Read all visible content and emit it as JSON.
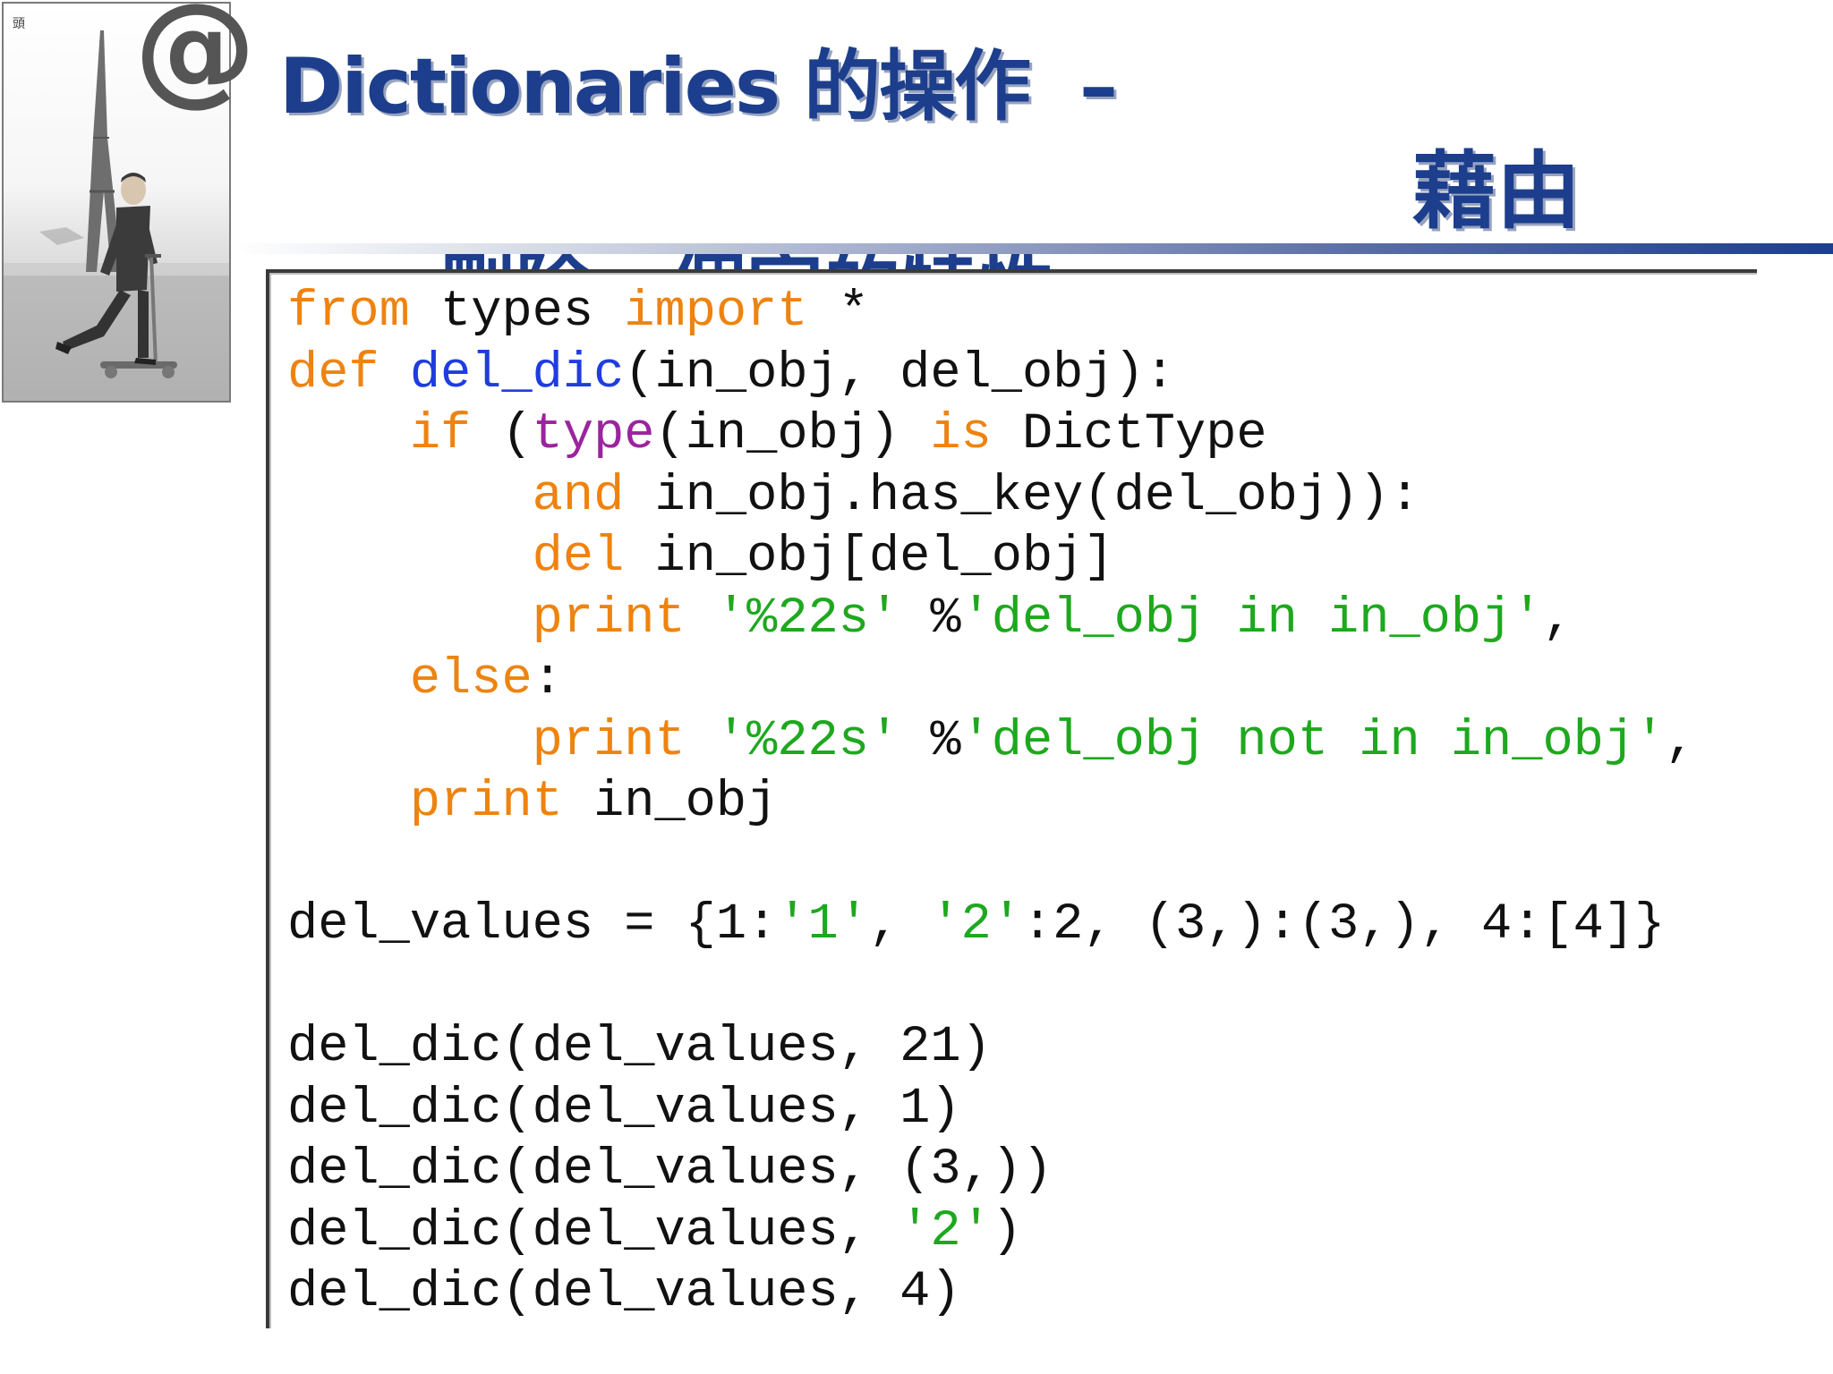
{
  "slide": {
    "corner_mark": "頭",
    "at_icon": "@",
    "title_line1": "Dictionaries 的操作",
    "title_dash": "–",
    "title_line2": "藉由",
    "title_line3": "刪除一個字的特性"
  },
  "code": {
    "lines": [
      [
        {
          "t": "from",
          "c": "k"
        },
        {
          "t": " types "
        },
        {
          "t": "import",
          "c": "k"
        },
        {
          "t": " *"
        }
      ],
      [
        {
          "t": "def",
          "c": "k"
        },
        {
          "t": " "
        },
        {
          "t": "del_dic",
          "c": "f"
        },
        {
          "t": "(in_obj, del_obj):"
        }
      ],
      [
        {
          "t": "    "
        },
        {
          "t": "if",
          "c": "k"
        },
        {
          "t": " ("
        },
        {
          "t": "type",
          "c": "b"
        },
        {
          "t": "(in_obj) "
        },
        {
          "t": "is",
          "c": "k"
        },
        {
          "t": " DictType"
        }
      ],
      [
        {
          "t": "        "
        },
        {
          "t": "and",
          "c": "k"
        },
        {
          "t": " in_obj.has_key(del_obj)):"
        }
      ],
      [
        {
          "t": "        "
        },
        {
          "t": "del",
          "c": "k"
        },
        {
          "t": " in_obj[del_obj]"
        }
      ],
      [
        {
          "t": "        "
        },
        {
          "t": "print",
          "c": "k"
        },
        {
          "t": " "
        },
        {
          "t": "'%22s'",
          "c": "s"
        },
        {
          "t": " %"
        },
        {
          "t": "'del_obj in in_obj'",
          "c": "s"
        },
        {
          "t": ","
        }
      ],
      [
        {
          "t": "    "
        },
        {
          "t": "else",
          "c": "k"
        },
        {
          "t": ":"
        }
      ],
      [
        {
          "t": "        "
        },
        {
          "t": "print",
          "c": "k"
        },
        {
          "t": " "
        },
        {
          "t": "'%22s'",
          "c": "s"
        },
        {
          "t": " %"
        },
        {
          "t": "'del_obj not in in_obj'",
          "c": "s"
        },
        {
          "t": ","
        }
      ],
      [
        {
          "t": "    "
        },
        {
          "t": "print",
          "c": "k"
        },
        {
          "t": " in_obj"
        }
      ],
      [],
      [
        {
          "t": "del_values = {1:"
        },
        {
          "t": "'1'",
          "c": "s"
        },
        {
          "t": ", "
        },
        {
          "t": "'2'",
          "c": "s"
        },
        {
          "t": ":2, (3,):(3,), 4:[4]}"
        }
      ],
      [],
      [
        {
          "t": "del_dic(del_values, 21)"
        }
      ],
      [
        {
          "t": "del_dic(del_values, 1)"
        }
      ],
      [
        {
          "t": "del_dic(del_values, (3,))"
        }
      ],
      [
        {
          "t": "del_dic(del_values, "
        },
        {
          "t": "'2'",
          "c": "s"
        },
        {
          "t": ")"
        }
      ],
      [
        {
          "t": "del_dic(del_values, 4)"
        }
      ]
    ]
  },
  "colors": {
    "title": "#1c3e8c",
    "keyword": "#ee8310",
    "function_name": "#1f3ce0",
    "builtin": "#9b249e",
    "string": "#1ea81e",
    "text": "#111111"
  }
}
